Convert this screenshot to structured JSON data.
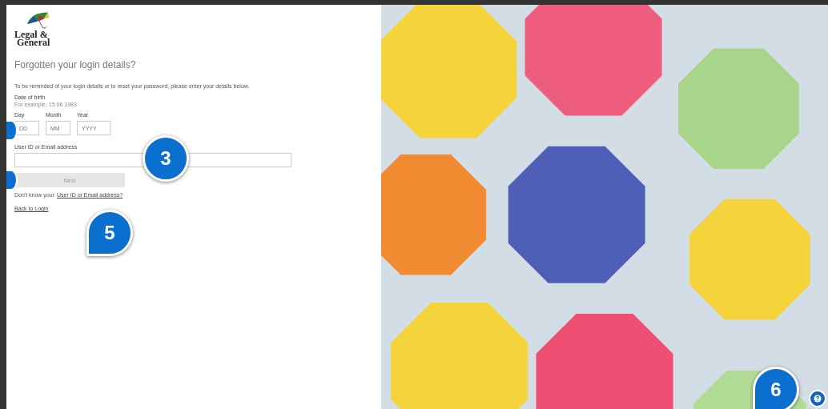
{
  "logo": {
    "line_1": "Legal &",
    "line_2": "General"
  },
  "heading": "Forgotten your login details?",
  "intro": "To be reminded of your login details or to reset your password, please enter your details below.",
  "dob": {
    "label": "Date of birth",
    "hint": "For example, 15 06 1983",
    "fields": [
      {
        "label": "Day",
        "placeholder": "DD"
      },
      {
        "label": "Month",
        "placeholder": "MM"
      },
      {
        "label": "Year",
        "placeholder": "YYYY"
      }
    ]
  },
  "user_field": {
    "label": "User ID or Email address"
  },
  "next_button": {
    "label": "Next",
    "disabled": true
  },
  "help_text": {
    "prefix": "Don't know your",
    "link": "User ID or Email address?"
  },
  "back_link": "Back to Login",
  "callouts": [
    {
      "number": "3"
    },
    {
      "number": "5"
    },
    {
      "number": "6"
    }
  ]
}
